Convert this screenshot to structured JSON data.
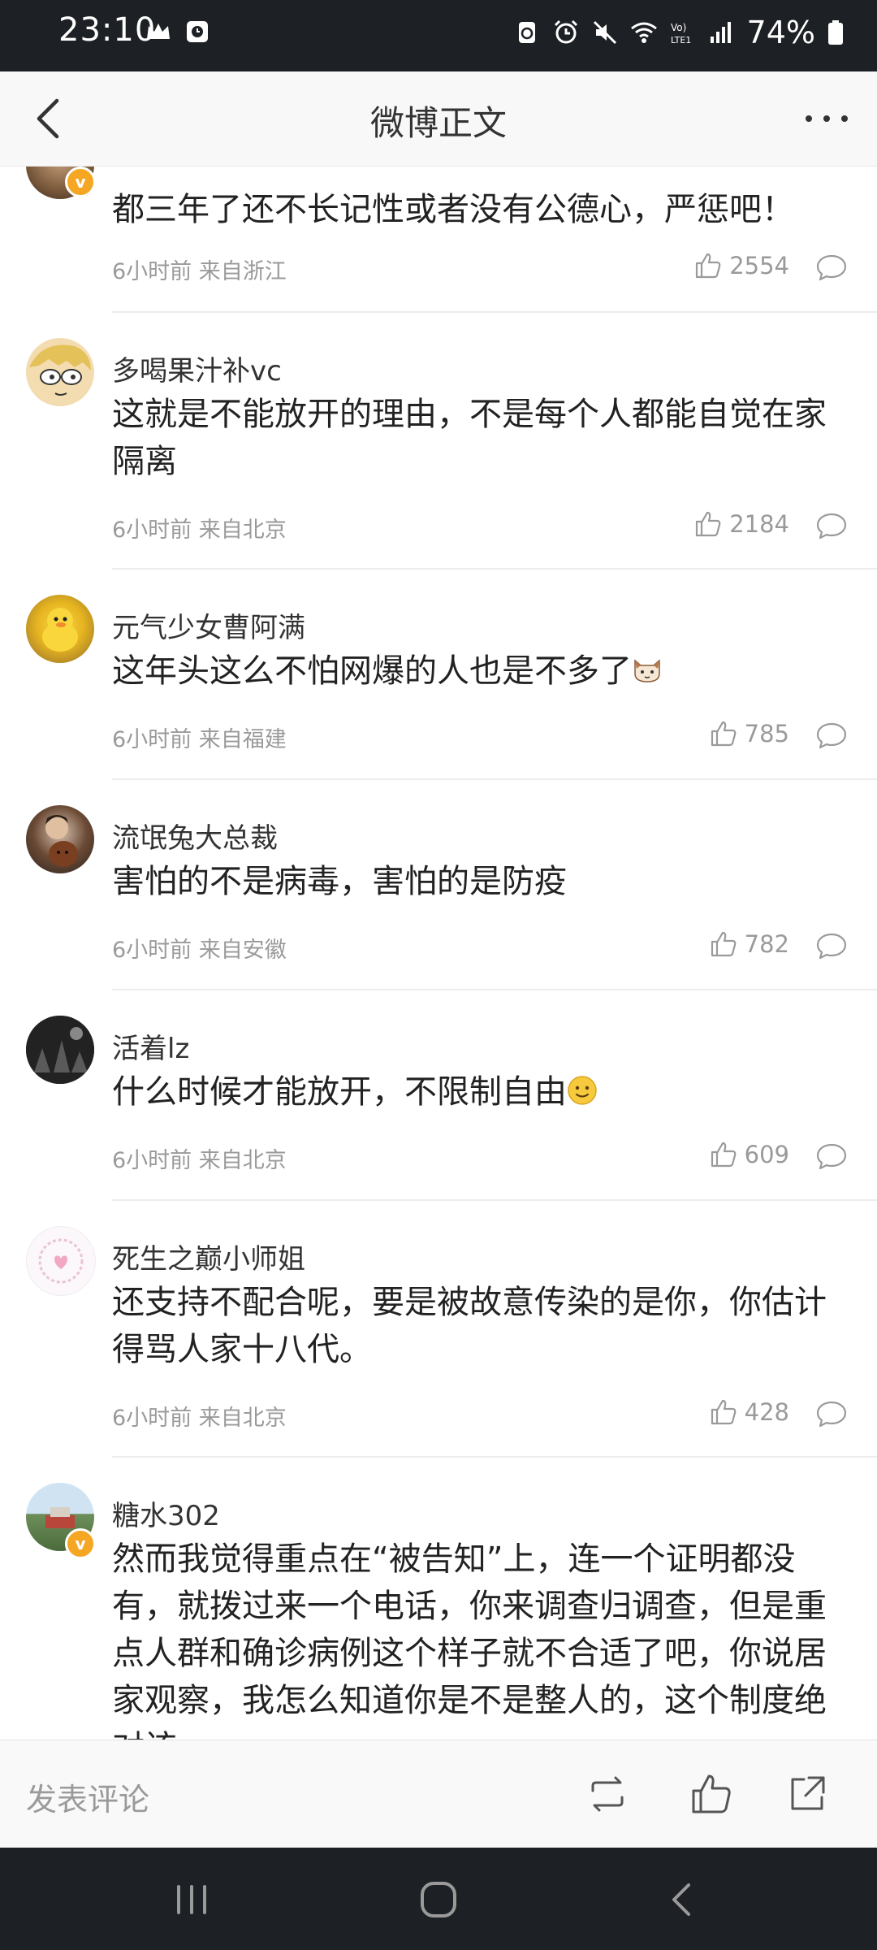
{
  "status_bar": {
    "time": "23:10",
    "battery": "74%",
    "left_icons": [
      "crown-icon",
      "square-clock-icon"
    ],
    "right_icons": [
      "recycle-icon",
      "alarm-icon",
      "mute-icon",
      "wifi-icon",
      "volte-icon",
      "signal-icon",
      "battery-icon"
    ]
  },
  "nav": {
    "title": "微博正文",
    "back_icon": "chevron-left-icon",
    "more_icon": "more-dots-icon"
  },
  "comments": [
    {
      "username": "",
      "verified": true,
      "text": "都三年了还不长记性或者没有公德心，严惩吧！",
      "meta": "6小时前 来自浙江",
      "likes": "2554"
    },
    {
      "username": "多喝果汁补vc",
      "verified": false,
      "text": "这就是不能放开的理由，不是每个人都能自觉在家隔离",
      "meta": "6小时前 来自北京",
      "likes": "2184"
    },
    {
      "username": "元气少女曹阿满",
      "verified": false,
      "text": "这年头这么不怕网爆的人也是不多了",
      "emoji": "cat-face-emoji",
      "meta": "6小时前 来自福建",
      "likes": "785"
    },
    {
      "username": "流氓兔大总裁",
      "verified": false,
      "text": "害怕的不是病毒，害怕的是防疫",
      "meta": "6小时前 来自安徽",
      "likes": "782"
    },
    {
      "username": "活着lz",
      "verified": false,
      "text": "什么时候才能放开，不限制自由",
      "emoji": "smile-emoji",
      "meta": "6小时前 来自北京",
      "likes": "609"
    },
    {
      "username": "死生之巅小师姐",
      "verified": false,
      "text": "还支持不配合呢，要是被故意传染的是你，你估计得骂人家十八代。",
      "meta": "6小时前 来自北京",
      "likes": "428"
    },
    {
      "username": "糖水302",
      "verified": true,
      "text": "然而我觉得重点在“被告知”上，连一个证明都没有，就拨过来一个电话，你来调查归调查，但是重点人群和确诊病例这个样子就不合适了吧，你说居家观察，我怎么知道你是不是整人的，这个制度绝对该",
      "meta": "",
      "likes": ""
    }
  ],
  "toolbar": {
    "placeholder": "发表评论",
    "icons": [
      "repost-icon",
      "like-icon",
      "share-icon"
    ]
  },
  "system_nav": {
    "icons": [
      "recent-apps-icon",
      "home-icon",
      "back-icon"
    ]
  }
}
